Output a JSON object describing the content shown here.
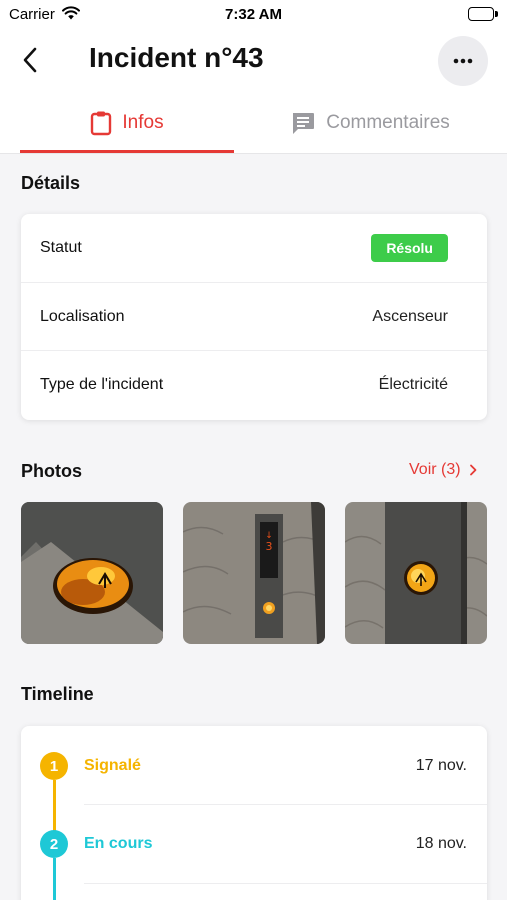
{
  "status_bar": {
    "carrier": "Carrier",
    "time": "7:32 AM"
  },
  "header": {
    "title": "Incident n°43"
  },
  "tabs": [
    {
      "label": "Infos",
      "active": true
    },
    {
      "label": "Commentaires",
      "active": false
    }
  ],
  "details": {
    "title": "Détails",
    "rows": [
      {
        "label": "Statut",
        "value": "Résolu"
      },
      {
        "label": "Localisation",
        "value": "Ascenseur"
      },
      {
        "label": "Type de l'incident",
        "value": "Électricité"
      }
    ]
  },
  "photos": {
    "title": "Photos",
    "link": "Voir (3)"
  },
  "timeline": {
    "title": "Timeline",
    "steps": [
      {
        "number": "1",
        "label": "Signalé",
        "date": "17 nov.",
        "color": "#f5b400"
      },
      {
        "number": "2",
        "label": "En cours",
        "date": "18 nov.",
        "color": "#1ec8d6"
      }
    ]
  },
  "colors": {
    "accent": "#e53935",
    "status_resolved": "#3dcc4a",
    "tab_inactive": "#9a9a9f"
  },
  "icons": [
    "wifi-icon",
    "battery-icon",
    "back-chevron-icon",
    "more-dots-icon",
    "clipboard-icon",
    "comment-icon",
    "chevron-right-icon"
  ]
}
